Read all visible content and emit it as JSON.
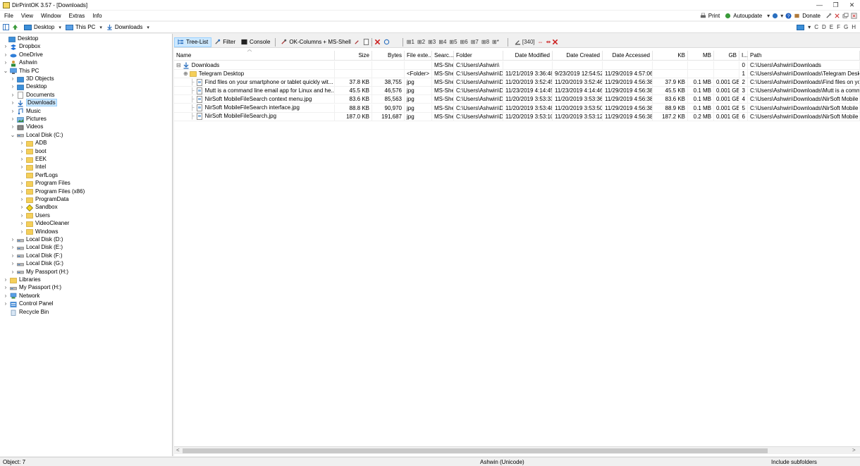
{
  "window": {
    "title": "DirPrintOK 3.57 - [Downloads]",
    "min": "—",
    "max": "❐",
    "close": "✕"
  },
  "menu": {
    "items": [
      "File",
      "View",
      "Window",
      "Extras",
      "Info"
    ],
    "print": "Print",
    "autoupdate": "Autoupdate",
    "donate": "Donate"
  },
  "address": {
    "crumbs": [
      "Desktop",
      "This PC",
      "Downloads"
    ],
    "drive_letters": [
      "C",
      "D",
      "E",
      "F",
      "G",
      "H"
    ]
  },
  "tree": [
    {
      "label": "Desktop",
      "level": 0,
      "icon": "folder-blue",
      "exp": ""
    },
    {
      "label": "Dropbox",
      "level": 1,
      "icon": "dropbox",
      "exp": ">"
    },
    {
      "label": "OneDrive",
      "level": 1,
      "icon": "cloud",
      "exp": ">"
    },
    {
      "label": "Ashwin",
      "level": 1,
      "icon": "user",
      "exp": ">"
    },
    {
      "label": "This PC",
      "level": 1,
      "icon": "pc",
      "exp": "v"
    },
    {
      "label": "3D Objects",
      "level": 2,
      "icon": "folder-blue",
      "exp": ">"
    },
    {
      "label": "Desktop",
      "level": 2,
      "icon": "folder-blue",
      "exp": ">"
    },
    {
      "label": "Documents",
      "level": 2,
      "icon": "doc",
      "exp": ">"
    },
    {
      "label": "Downloads",
      "level": 2,
      "icon": "download",
      "exp": ">",
      "selected": true
    },
    {
      "label": "Music",
      "level": 2,
      "icon": "music",
      "exp": ">"
    },
    {
      "label": "Pictures",
      "level": 2,
      "icon": "pictures",
      "exp": ">"
    },
    {
      "label": "Videos",
      "level": 2,
      "icon": "videos",
      "exp": ">"
    },
    {
      "label": "Local Disk (C:)",
      "level": 2,
      "icon": "drive",
      "exp": "v"
    },
    {
      "label": "ADB",
      "level": 3,
      "icon": "folder",
      "exp": ">"
    },
    {
      "label": "boot",
      "level": 3,
      "icon": "folder",
      "exp": ">"
    },
    {
      "label": "EEK",
      "level": 3,
      "icon": "folder",
      "exp": ">"
    },
    {
      "label": "Intel",
      "level": 3,
      "icon": "folder",
      "exp": ">"
    },
    {
      "label": "PerfLogs",
      "level": 3,
      "icon": "folder",
      "exp": ""
    },
    {
      "label": "Program Files",
      "level": 3,
      "icon": "folder",
      "exp": ">"
    },
    {
      "label": "Program Files (x86)",
      "level": 3,
      "icon": "folder",
      "exp": ">"
    },
    {
      "label": "ProgramData",
      "level": 3,
      "icon": "folder",
      "exp": ">"
    },
    {
      "label": "Sandbox",
      "level": 3,
      "icon": "sandbox",
      "exp": ">"
    },
    {
      "label": "Users",
      "level": 3,
      "icon": "folder",
      "exp": ">"
    },
    {
      "label": "VideoCleaner",
      "level": 3,
      "icon": "folder",
      "exp": ">"
    },
    {
      "label": "Windows",
      "level": 3,
      "icon": "folder",
      "exp": ">"
    },
    {
      "label": "Local Disk (D:)",
      "level": 2,
      "icon": "drive",
      "exp": ">"
    },
    {
      "label": "Local Disk (E:)",
      "level": 2,
      "icon": "drive",
      "exp": ">"
    },
    {
      "label": "Local Disk (F:)",
      "level": 2,
      "icon": "drive",
      "exp": ">"
    },
    {
      "label": "Local Disk (G:)",
      "level": 2,
      "icon": "drive",
      "exp": ">"
    },
    {
      "label": "My Passport (H:)",
      "level": 2,
      "icon": "drive",
      "exp": ">"
    },
    {
      "label": "Libraries",
      "level": 1,
      "icon": "folder",
      "exp": ">"
    },
    {
      "label": "My Passport (H:)",
      "level": 1,
      "icon": "drive",
      "exp": ">"
    },
    {
      "label": "Network",
      "level": 1,
      "icon": "network",
      "exp": ">"
    },
    {
      "label": "Control Panel",
      "level": 1,
      "icon": "control",
      "exp": ">"
    },
    {
      "label": "Recycle Bin",
      "level": 1,
      "icon": "recycle",
      "exp": ""
    }
  ],
  "toolbar": {
    "tree_list": "Tree-List",
    "filter": "Filter",
    "console": "Console",
    "ok_columns": "OK-Columns + MS-Shell",
    "count": "[340]"
  },
  "columns": [
    "Name",
    "Size",
    "Bytes",
    "File exte...",
    "Searc...",
    "Folder",
    "Date Modified",
    "Date Created",
    "Date Accessed",
    "KB",
    "MB",
    "GB",
    "I...",
    "Path"
  ],
  "rows": [
    {
      "name": "Downloads",
      "indent": 0,
      "icon": "download",
      "exp": "⊟",
      "size": "",
      "bytes": "",
      "ext": "",
      "search": "MS-Shell",
      "folder": "C:\\Users\\Ashwin\\",
      "modified": "",
      "created": "",
      "accessed": "",
      "kb": "",
      "mb": "",
      "gb": "",
      "idx": "0",
      "path": "C:\\Users\\Ashwin\\Downloads"
    },
    {
      "name": "Telegram Desktop",
      "indent": 1,
      "icon": "folder",
      "exp": "⊕",
      "size": "",
      "bytes": "",
      "ext": "<Folder>",
      "search": "MS-Shell",
      "folder": "C:\\Users\\Ashwin\\Downlo...",
      "modified": "11/21/2019 3:36:48...",
      "created": "9/23/2019 12:54:52...",
      "accessed": "11/29/2019 4:57:06...",
      "kb": "",
      "mb": "",
      "gb": "",
      "idx": "1",
      "path": "C:\\Users\\Ashwin\\Downloads\\Telegram Deskt"
    },
    {
      "name": "Find files on your smartphone or tablet quickly wit...",
      "indent": 2,
      "icon": "file",
      "exp": "",
      "size": "37.8 KB",
      "bytes": "38,755",
      "ext": "jpg",
      "search": "MS-Shell",
      "folder": "C:\\Users\\Ashwin\\Downlo...",
      "modified": "11/20/2019 3:52:45...",
      "created": "11/20/2019 3:52:46...",
      "accessed": "11/29/2019 4:56:38...",
      "kb": "37.9 KB",
      "mb": "0.1 MB",
      "gb": "0.001 GB",
      "idx": "2",
      "path": "C:\\Users\\Ashwin\\Downloads\\Find files on yo"
    },
    {
      "name": "Mutt is a command line email app for Linux and he...",
      "indent": 2,
      "icon": "file",
      "exp": "",
      "size": "45.5 KB",
      "bytes": "46,576",
      "ext": "jpg",
      "search": "MS-Shell",
      "folder": "C:\\Users\\Ashwin\\Downlo...",
      "modified": "11/23/2019 4:14:45...",
      "created": "11/23/2019 4:14:46...",
      "accessed": "11/29/2019 4:56:38...",
      "kb": "45.5 KB",
      "mb": "0.1 MB",
      "gb": "0.001 GB",
      "idx": "3",
      "path": "C:\\Users\\Ashwin\\Downloads\\Mutt is a comm"
    },
    {
      "name": "NirSoft MobileFileSearch context menu.jpg",
      "indent": 2,
      "icon": "file",
      "exp": "",
      "size": "83.6 KB",
      "bytes": "85,563",
      "ext": "jpg",
      "search": "MS-Shell",
      "folder": "C:\\Users\\Ashwin\\Downlo...",
      "modified": "11/20/2019 3:53:33...",
      "created": "11/20/2019 3:53:36...",
      "accessed": "11/29/2019 4:56:38...",
      "kb": "83.6 KB",
      "mb": "0.1 MB",
      "gb": "0.001 GB",
      "idx": "4",
      "path": "C:\\Users\\Ashwin\\Downloads\\NirSoft Mobile"
    },
    {
      "name": "NirSoft MobileFileSearch interface.jpg",
      "indent": 2,
      "icon": "file",
      "exp": "",
      "size": "88.8 KB",
      "bytes": "90,970",
      "ext": "jpg",
      "search": "MS-Shell",
      "folder": "C:\\Users\\Ashwin\\Downlo...",
      "modified": "11/20/2019 3:53:48...",
      "created": "11/20/2019 3:53:50...",
      "accessed": "11/29/2019 4:56:38...",
      "kb": "88.9 KB",
      "mb": "0.1 MB",
      "gb": "0.001 GB",
      "idx": "5",
      "path": "C:\\Users\\Ashwin\\Downloads\\NirSoft Mobile"
    },
    {
      "name": "NirSoft MobileFileSearch.jpg",
      "indent": 2,
      "icon": "file",
      "exp": "",
      "size": "187.0 KB",
      "bytes": "191,687",
      "ext": "jpg",
      "search": "MS-Shell",
      "folder": "C:\\Users\\Ashwin\\Downlo...",
      "modified": "11/20/2019 3:53:10...",
      "created": "11/20/2019 3:53:12...",
      "accessed": "11/29/2019 4:56:38...",
      "kb": "187.2 KB",
      "mb": "0.2 MB",
      "gb": "0.001 GB",
      "idx": "6",
      "path": "C:\\Users\\Ashwin\\Downloads\\NirSoft Mobile"
    }
  ],
  "status": {
    "objects": "Object: 7",
    "user": "Ashwin (Unicode)",
    "option": "Include subfolders"
  },
  "colors": {
    "accent": "#cce8ff",
    "accent_border": "#99d1ff",
    "folder": "#f5cf5a",
    "blue": "#3c8fd9"
  }
}
